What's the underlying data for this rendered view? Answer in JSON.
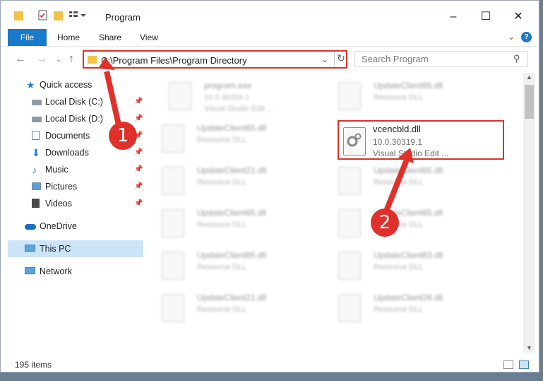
{
  "window": {
    "title": "Program"
  },
  "ribbon": {
    "tabs": [
      "File",
      "Home",
      "Share",
      "View"
    ]
  },
  "address": {
    "path": "C:\\Program Files\\Program Directory"
  },
  "search": {
    "placeholder": "Search Program"
  },
  "sidebar": {
    "items": [
      {
        "label": "Quick access",
        "icon": "star-icon"
      },
      {
        "label": "Local Disk (C:)",
        "icon": "drive-icon"
      },
      {
        "label": "Local Disk (D:)",
        "icon": "drive-icon"
      },
      {
        "label": "Documents",
        "icon": "documents-icon"
      },
      {
        "label": "Downloads",
        "icon": "download-icon"
      },
      {
        "label": "Music",
        "icon": "music-icon"
      },
      {
        "label": "Pictures",
        "icon": "pictures-icon"
      },
      {
        "label": "Videos",
        "icon": "videos-icon"
      },
      {
        "label": "OneDrive",
        "icon": "cloud-icon"
      },
      {
        "label": "This PC",
        "icon": "computer-icon"
      },
      {
        "label": "Network",
        "icon": "network-icon"
      }
    ]
  },
  "files": [
    {
      "name": "program.exe",
      "line2": "10.0.30319.1",
      "line3": "Visual Studio Edit ..."
    },
    {
      "name": "UpdateClient65.dll",
      "line2": "Resource DLL",
      "line3": ""
    },
    {
      "name": "UpdateClient65.dll",
      "line2": "Resource DLL",
      "line3": ""
    },
    {
      "name": "vcencbld.dll",
      "line2": "10.0.30319.1",
      "line3": "Visual Studio Edit ..."
    },
    {
      "name": "UpdateClient21.dll",
      "line2": "Resource DLL",
      "line3": ""
    },
    {
      "name": "UpdateClient65.dll",
      "line2": "Resource DLL",
      "line3": ""
    },
    {
      "name": "UpdateClient65.dll",
      "line2": "Resource DLL",
      "line3": ""
    },
    {
      "name": "UpdateClient65.dll",
      "line2": "Resource DLL",
      "line3": ""
    },
    {
      "name": "UpdateClient65.dll",
      "line2": "Resource DLL",
      "line3": ""
    },
    {
      "name": "UpdateClient63.dll",
      "line2": "Resource DLL",
      "line3": ""
    },
    {
      "name": "UpdateClient21.dll",
      "line2": "Resource DLL",
      "line3": ""
    },
    {
      "name": "UpdateClient28.dll",
      "line2": "Resource DLL",
      "line3": ""
    }
  ],
  "status": {
    "item_count": "195 items"
  },
  "annotations": {
    "step1": "1",
    "step2": "2",
    "accent": "#e0302b"
  }
}
